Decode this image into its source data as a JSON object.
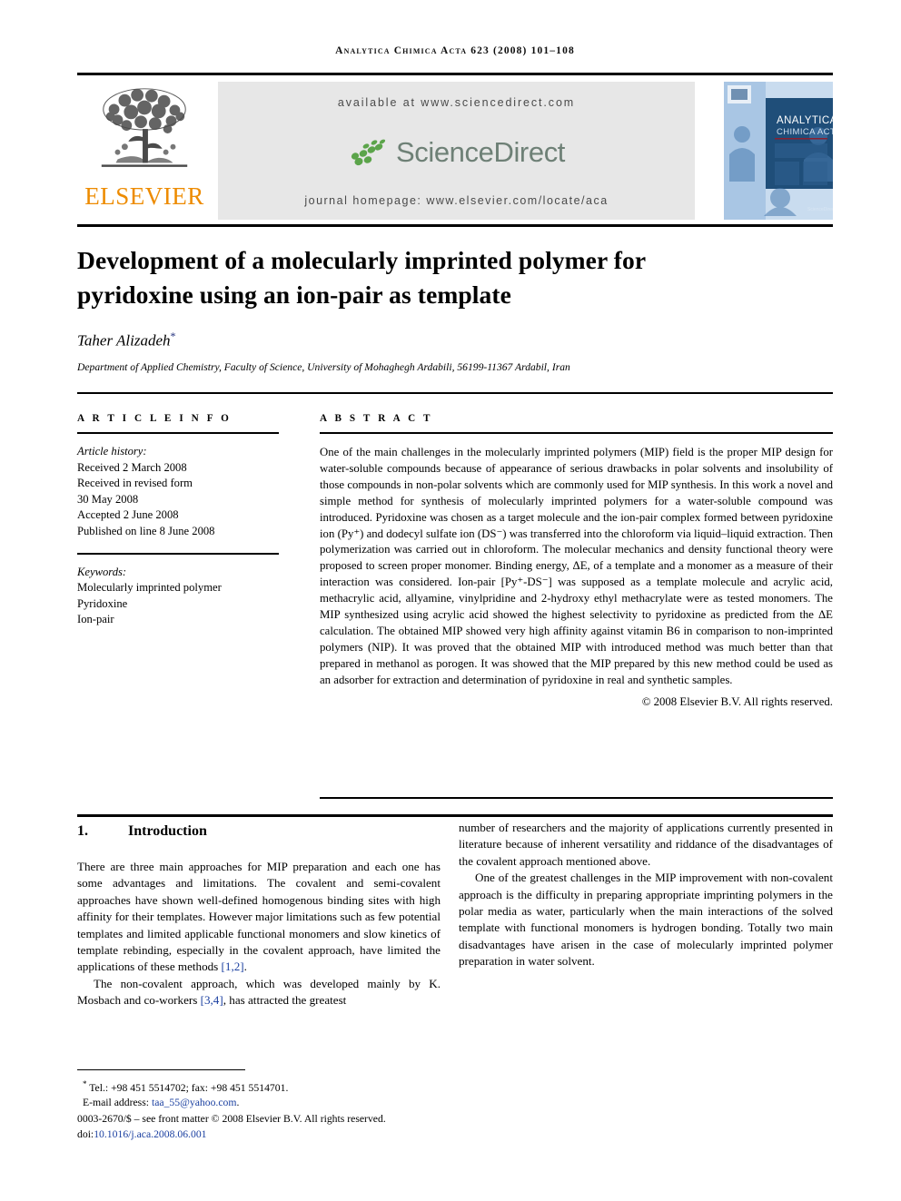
{
  "running_head": "Analytica Chimica Acta 623 (2008) 101–108",
  "masthead": {
    "publisher_wordmark": "ELSEVIER",
    "available_at": "available at www.sciencedirect.com",
    "sciencedirect_wordmark": "ScienceDirect",
    "journal_homepage": "journal homepage: www.elsevier.com/locate/aca",
    "cover_title_line1": "ANALYTICA",
    "cover_title_line2": "CHIMICA ACTA",
    "colors": {
      "elsevier_orange": "#ED8B00",
      "sciencedirect_green": "#5BA44A",
      "sciencedirect_text": "#6E8076",
      "banner_grey": "#E7E7E7",
      "cover_blue": "#1F4E79",
      "link_blue": "#1A3FA0"
    }
  },
  "title": "Development of a molecularly imprinted polymer for pyridoxine using an ion-pair as template",
  "author": "Taher Alizadeh",
  "author_footnote_marker": "*",
  "affiliation": "Department of Applied Chemistry, Faculty of Science, University of Mohaghegh Ardabili, 56199-11367 Ardabil, Iran",
  "article_info": {
    "heading": "A R T I C L E   I N F O",
    "history_label": "Article history:",
    "history": [
      "Received 2 March 2008",
      "Received in revised form",
      "30 May 2008",
      "Accepted 2 June 2008",
      "Published on line 8 June 2008"
    ],
    "keywords_label": "Keywords:",
    "keywords": [
      "Molecularly imprinted polymer",
      "Pyridoxine",
      "Ion-pair"
    ]
  },
  "abstract": {
    "heading": "A B S T R A C T",
    "text": "One of the main challenges in the molecularly imprinted polymers (MIP) field is the proper MIP design for water-soluble compounds because of appearance of serious drawbacks in polar solvents and insolubility of those compounds in non-polar solvents which are commonly used for MIP synthesis. In this work a novel and simple method for synthesis of molecularly imprinted polymers for a water-soluble compound was introduced. Pyridoxine was chosen as a target molecule and the ion-pair complex formed between pyridoxine ion (Py⁺) and dodecyl sulfate ion (DS⁻) was transferred into the chloroform via liquid–liquid extraction. Then polymerization was carried out in chloroform. The molecular mechanics and density functional theory were proposed to screen proper monomer. Binding energy, ΔE, of a template and a monomer as a measure of their interaction was considered. Ion-pair [Py⁺-DS⁻] was supposed as a template molecule and acrylic acid, methacrylic acid, allyamine, vinylpridine and 2-hydroxy ethyl methacrylate were as tested monomers. The MIP synthesized using acrylic acid showed the highest selectivity to pyridoxine as predicted from the ΔE calculation. The obtained MIP showed very high affinity against vitamin B6 in comparison to non-imprinted polymers (NIP). It was proved that the obtained MIP with introduced method was much better than that prepared in methanol as porogen. It was showed that the MIP prepared by this new method could be used as an adsorber for extraction and determination of pyridoxine in real and synthetic samples.",
    "copyright": "© 2008 Elsevier B.V. All rights reserved."
  },
  "introduction": {
    "number": "1.",
    "heading": "Introduction",
    "left_paragraphs": [
      "There are three main approaches for MIP preparation and each one has some advantages and limitations. The covalent and semi-covalent approaches have shown well-defined homogenous binding sites with high affinity for their templates. However major limitations such as few potential templates and limited applicable functional monomers and slow kinetics of template rebinding, especially in the covalent approach, have limited the applications of these methods [1,2].",
      "The non-covalent approach, which was developed mainly by K. Mosbach and co-workers [3,4], has attracted the greatest"
    ],
    "right_paragraphs": [
      "number of researchers and the majority of applications currently presented in literature because of inherent versatility and riddance of the disadvantages of the covalent approach mentioned above.",
      "One of the greatest challenges in the MIP improvement with non-covalent approach is the difficulty in preparing appropriate imprinting polymers in the polar media as water, particularly when the main interactions of the solved template with functional monomers is hydrogen bonding. Totally two main disadvantages have arisen in the case of molecularly imprinted polymer preparation in water solvent."
    ],
    "citations": [
      "[1,2]",
      "[3,4]"
    ]
  },
  "footnotes": {
    "tel_line": "Tel.: +98 451 5514702; fax: +98 451 5514701.",
    "email_label": "E-mail address:",
    "email": "taa_55@yahoo.com",
    "email_suffix": ".",
    "issn_line": "0003-2670/$ – see front matter © 2008 Elsevier B.V. All rights reserved.",
    "doi_label": "doi:",
    "doi": "10.1016/j.aca.2008.06.001"
  }
}
